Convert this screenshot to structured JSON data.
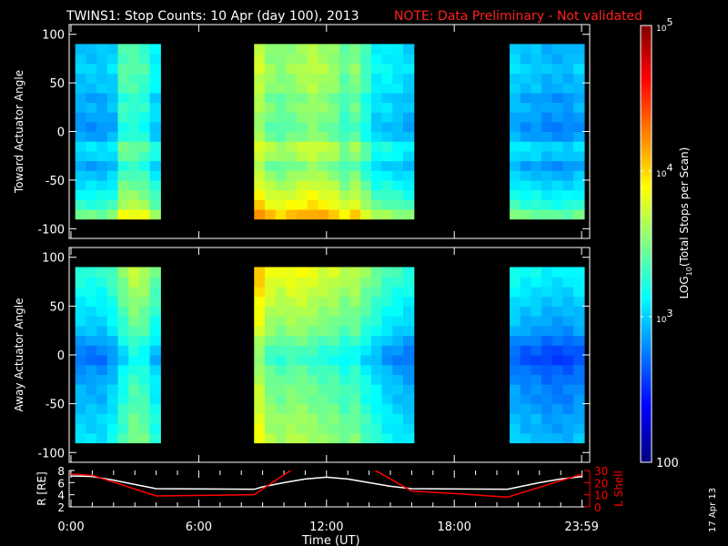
{
  "chart_data": {
    "type": "heatmap",
    "title": "TWINS1: Stop Counts: 10 Apr (day 100), 2013",
    "note": "NOTE: Data Preliminary - Not validated",
    "side_date": "17 Apr 13",
    "xlabel": "Time (UT)",
    "x_ticks": [
      {
        "t": 0,
        "label": "0:00"
      },
      {
        "t": 6,
        "label": "6:00"
      },
      {
        "t": 12,
        "label": "12:00"
      },
      {
        "t": 18,
        "label": "18:00"
      },
      {
        "t": 23.98,
        "label": "23:59"
      }
    ],
    "xlim": [
      0,
      24
    ],
    "colorbar": {
      "label": "LOG10(Total Stops per Scan)",
      "label_main": "LOG",
      "label_sub": "10",
      "label_rest": "(Total Stops per Scan)",
      "range_log10": [
        2,
        5
      ],
      "ticks": [
        {
          "v": 5,
          "base": "10",
          "exp": "5"
        },
        {
          "v": 4,
          "base": "10",
          "exp": "4"
        },
        {
          "v": 3,
          "base": "10",
          "exp": "3"
        },
        {
          "v": 2,
          "base": "100",
          "exp": ""
        }
      ]
    },
    "panels": [
      {
        "ylabel": "Toward Actuator Angle",
        "ylim": [
          -110,
          110
        ],
        "y_ticks": [
          100,
          50,
          0,
          -50,
          -100
        ],
        "angle_range": [
          -90,
          90
        ],
        "angle_profile": [
          0.5,
          0.3,
          0.2,
          0.1,
          0,
          -0.1,
          0.05,
          0.1,
          -0.1,
          -0.15,
          -0.1,
          -0.05,
          -0.1,
          0,
          0,
          0.05,
          0,
          0
        ],
        "bin_hours": 0.5,
        "segments": [
          {
            "start": 0.2,
            "log_counts": [
              2.95,
              2.95,
              2.95,
              3.0,
              3.35,
              3.35,
              3.3,
              3.1
            ]
          },
          {
            "start": 8.6,
            "log_counts": [
              3.7,
              3.55,
              3.5,
              3.55,
              3.6,
              3.65,
              3.6,
              3.55,
              3.4,
              3.5,
              3.3,
              3.1,
              3.1,
              3.05,
              3.0
            ]
          },
          {
            "start": 20.6,
            "log_counts": [
              3.0,
              2.95,
              2.95,
              2.9,
              2.9,
              2.9,
              2.95
            ]
          }
        ]
      },
      {
        "ylabel": "Away Actuator Angle",
        "ylim": [
          -110,
          110
        ],
        "y_ticks": [
          100,
          50,
          0,
          -50,
          -100
        ],
        "angle_range": [
          -90,
          90
        ],
        "angle_profile": [
          0.05,
          0,
          0,
          -0.05,
          -0.1,
          -0.1,
          -0.15,
          -0.2,
          -0.3,
          -0.25,
          -0.15,
          -0.05,
          0,
          0.05,
          0.1,
          0.15,
          0.2,
          0.25
        ],
        "bin_hours": 0.5,
        "segments": [
          {
            "start": 0.2,
            "log_counts": [
              3.0,
              3.0,
              3.0,
              3.1,
              3.3,
              3.45,
              3.4,
              3.2
            ]
          },
          {
            "start": 8.6,
            "log_counts": [
              3.8,
              3.6,
              3.55,
              3.6,
              3.6,
              3.55,
              3.5,
              3.5,
              3.4,
              3.45,
              3.3,
              3.2,
              3.1,
              3.05,
              3.0
            ]
          },
          {
            "start": 20.6,
            "log_counts": [
              2.95,
              2.9,
              2.9,
              2.85,
              2.85,
              2.85,
              2.9
            ]
          }
        ]
      }
    ],
    "orbit": {
      "left_label": "R [RE]",
      "left_ylim": [
        2,
        8
      ],
      "left_ticks": [
        8,
        6,
        4,
        2
      ],
      "right_label": "L Shell",
      "right_ylim": [
        0,
        30
      ],
      "right_ticks": [
        30,
        20,
        10,
        0
      ],
      "R": [
        [
          0,
          7.1
        ],
        [
          1,
          7.0
        ],
        [
          2,
          6.4
        ],
        [
          3,
          5.7
        ],
        [
          4,
          5.0
        ],
        [
          8.6,
          4.9
        ],
        [
          9,
          5.3
        ],
        [
          10,
          6.0
        ],
        [
          11,
          6.6
        ],
        [
          12,
          6.9
        ],
        [
          13,
          6.6
        ],
        [
          14,
          6.0
        ],
        [
          15,
          5.4
        ],
        [
          16,
          5.0
        ],
        [
          20.5,
          4.9
        ],
        [
          22,
          6.0
        ],
        [
          23,
          6.6
        ],
        [
          24,
          7.0
        ]
      ],
      "L": [
        [
          0,
          27
        ],
        [
          1,
          26
        ],
        [
          4,
          9
        ],
        [
          8.6,
          10
        ],
        [
          10.4,
          31
        ],
        null,
        [
          14.2,
          31
        ],
        [
          16,
          13
        ],
        [
          18,
          11
        ],
        [
          20.5,
          8
        ],
        [
          24,
          27
        ]
      ],
      "colors": {
        "R": "#ffffff",
        "L": "#ff0000"
      }
    }
  }
}
